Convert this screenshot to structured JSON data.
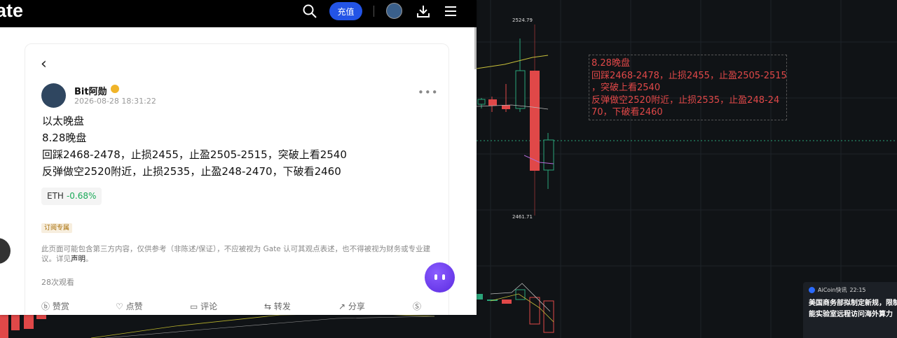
{
  "chart": {
    "price_high": "2524.79",
    "price_low": "2461.71"
  },
  "annotation": {
    "lines": [
      "8.28晚盘",
      "回踩2468-2478，止损2455，止盈2505-2515",
      "，突破上看2540",
      "反弹做空2520附近，止损2535，止盈248-24",
      "70，下破看2460"
    ]
  },
  "news": {
    "source": "AiCoin快讯",
    "time": "22:15",
    "line1": "美国商务部拟制定新规，限制",
    "line2": "能实验室远程访问海外算力"
  },
  "topbar": {
    "logo": "ate",
    "recharge_label": "充值",
    "icons": [
      "search-icon",
      "globe-avatar",
      "download-icon",
      "menu-icon"
    ]
  },
  "post": {
    "author": "Bit阿勋",
    "date": "2026-08-28 18:31:22",
    "title": "以太晚盘",
    "lines": [
      "8.28晚盘",
      "回踩2468-2478，止损2455，止盈2505-2515，突破上看2540",
      "反弹做空2520附近，止损2535，止盈248-2470，下破看2460"
    ],
    "tag": {
      "symbol": "ETH",
      "change": "-0.68%"
    },
    "subscription_badge": "订阅专属",
    "disclaimer_text": "此页面可能包含第三方内容，仅供参考（非陈述/保证），不应被视为 Gate 认可其观点表述，也不得被视为财务或专业建议。详见",
    "disclaimer_link": "声明",
    "disclaimer_end": "。",
    "views": "28次观看",
    "actions": {
      "tip": "赞赏",
      "like": "点赞",
      "comment": "评论",
      "repost": "转发",
      "share": "分享"
    }
  },
  "colors": {
    "up": "#18a957",
    "down": "#e04848",
    "brand": "#2354e6"
  }
}
